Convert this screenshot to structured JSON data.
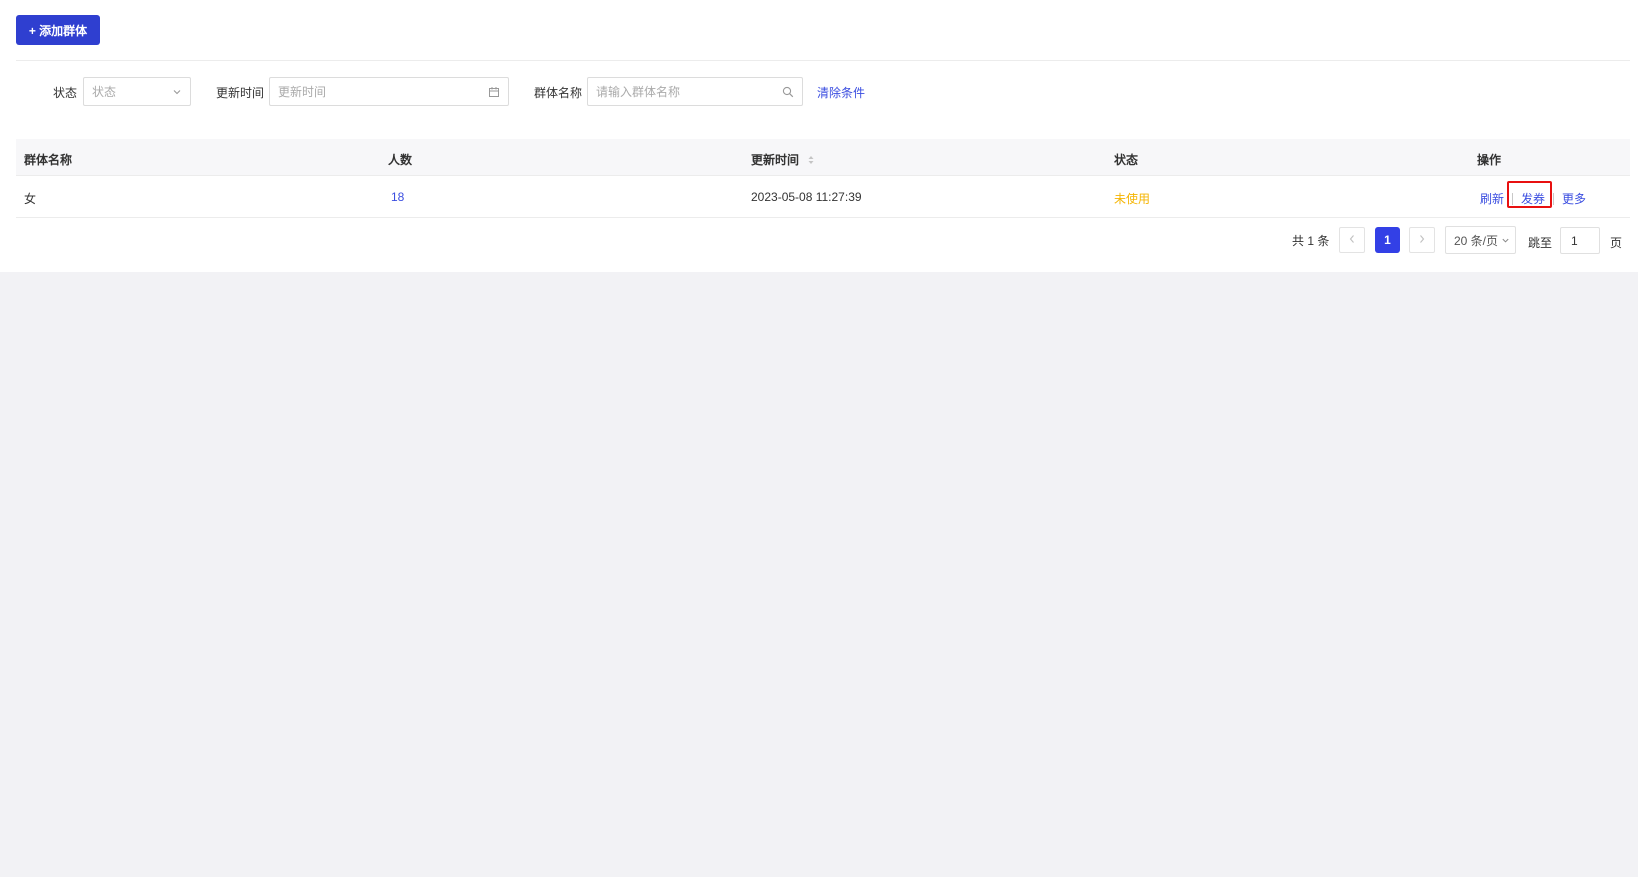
{
  "toolbar": {
    "add_label": "+ 添加群体"
  },
  "filters": {
    "status_label": "状态",
    "status_placeholder": "状态",
    "time_label": "更新时间",
    "time_placeholder": "更新时间",
    "name_label": "群体名称",
    "name_placeholder": "请输入群体名称",
    "clear_label": "清除条件"
  },
  "table": {
    "columns": [
      "群体名称",
      "人数",
      "更新时间",
      "状态",
      "操作"
    ],
    "rows": [
      {
        "name": "女",
        "count": "18",
        "updated": "2023-05-08 11:27:39",
        "status": "未使用",
        "actions": [
          "刷新",
          "发券",
          "更多"
        ]
      }
    ]
  },
  "pagination": {
    "total_text": "共 1 条",
    "prev_icon": "chevron-left-icon",
    "next_icon": "chevron-right-icon",
    "current_page": "1",
    "page_size": "20 条/页",
    "jump_label": "跳至",
    "jump_value": "1",
    "page_suffix": "页"
  },
  "colors": {
    "primary": "#2f3fd0",
    "link": "#3a4de0",
    "status_unused": "#f5b400",
    "highlight_box": "#e81010",
    "page_background": "#f2f2f5"
  }
}
